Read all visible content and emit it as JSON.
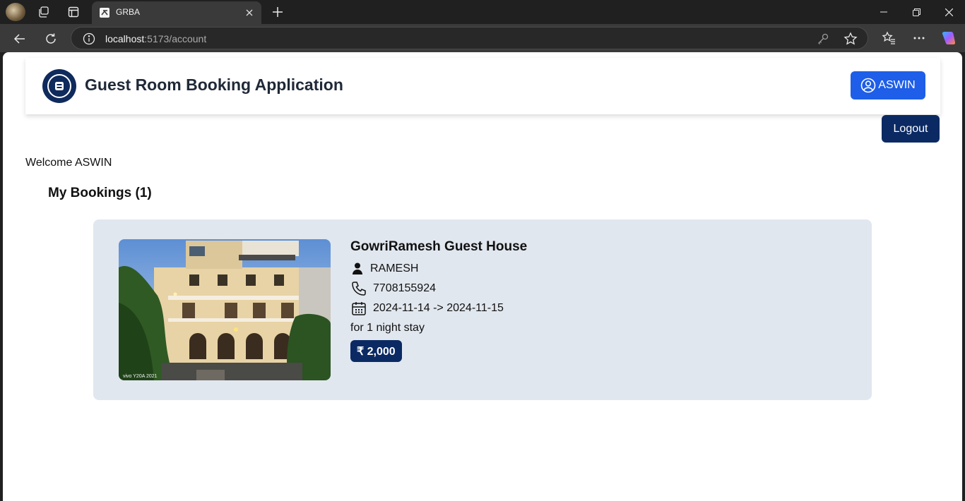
{
  "browser": {
    "tab_title": "GRBA",
    "url_host": "localhost",
    "url_path": ":5173/account"
  },
  "header": {
    "app_title": "Guest Room Booking Application",
    "user_button": "ASWIN"
  },
  "logout_label": "Logout",
  "welcome_text": "Welcome ASWIN",
  "bookings": {
    "title": "My Bookings (1)",
    "items": [
      {
        "name": "GowriRamesh Guest House",
        "owner": "RAMESH",
        "phone": "7708155924",
        "dates": "2024-11-14 -> 2024-11-15",
        "stay": "for 1 night stay",
        "price": "₹ 2,000",
        "photo_watermark": "vivo Y20A 2021"
      }
    ]
  },
  "colors": {
    "primary_blue": "#1e5ee8",
    "navy": "#0b2a63",
    "card_bg": "#e1e7ef"
  }
}
